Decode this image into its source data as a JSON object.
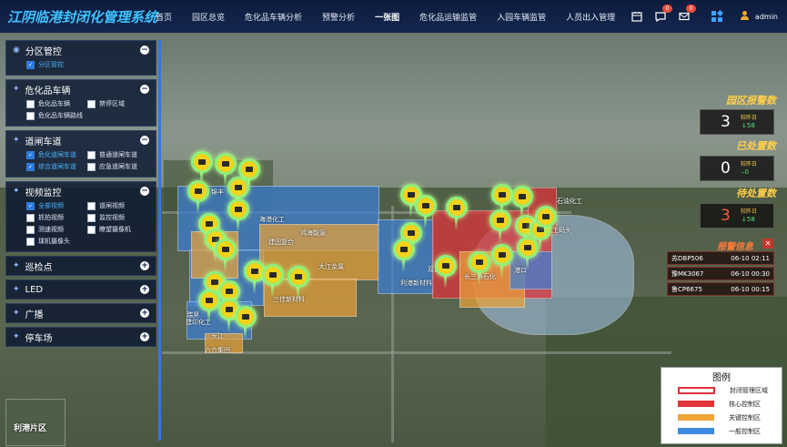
{
  "app": {
    "title": "江阴临港封闭化管理系统"
  },
  "nav": {
    "items": [
      "首页",
      "园区总览",
      "危化品车辆分析",
      "预警分析",
      "一张图",
      "危化品运输监管",
      "入园车辆监管",
      "人员出入管理"
    ],
    "active_index": 4
  },
  "header": {
    "calendar_icon": "calendar-icon",
    "message_badge": "0",
    "mail_badge": "0",
    "user": "admin"
  },
  "left_panel": {
    "sections": [
      {
        "title": "分区管控",
        "icon": "globe-icon",
        "expanded": true,
        "items": [
          {
            "label": "分区管控",
            "checked": true
          }
        ]
      },
      {
        "title": "危化品车辆",
        "icon": "star-icon",
        "expanded": true,
        "items": [
          {
            "label": "危化品车辆",
            "checked": false
          },
          {
            "label": "禁停区域",
            "checked": false
          },
          {
            "label": "危化品车辆路线",
            "checked": false
          }
        ]
      },
      {
        "title": "道闸车道",
        "icon": "star-icon",
        "expanded": true,
        "items": [
          {
            "label": "危化道闸车道",
            "checked": true
          },
          {
            "label": "普通道闸车道",
            "checked": false
          },
          {
            "label": "综合道闸车道",
            "checked": true
          },
          {
            "label": "应急道闸车道",
            "checked": false
          }
        ]
      },
      {
        "title": "视频监控",
        "icon": "star-icon",
        "expanded": true,
        "items": [
          {
            "label": "全部视频",
            "checked": true
          },
          {
            "label": "道闸视频",
            "checked": false
          },
          {
            "label": "抓拍视频",
            "checked": false
          },
          {
            "label": "监控视频",
            "checked": false
          },
          {
            "label": "测速视频",
            "checked": false
          },
          {
            "label": "瞭望摄像机",
            "checked": false
          },
          {
            "label": "球机摄像头",
            "checked": false
          }
        ]
      },
      {
        "title": "巡检点",
        "icon": "star-icon",
        "expanded": false,
        "items": []
      },
      {
        "title": "LED",
        "icon": "star-icon",
        "expanded": false,
        "items": []
      },
      {
        "title": "广播",
        "icon": "star-icon",
        "expanded": false,
        "items": []
      },
      {
        "title": "停车场",
        "icon": "star-icon",
        "expanded": false,
        "items": []
      }
    ]
  },
  "thumbnail": {
    "label": "利港片区"
  },
  "stats": [
    {
      "title": "园区报警数",
      "value": "3",
      "compare_label": "较昨日",
      "delta": "58",
      "direction": "down",
      "value_color": "#ffffff"
    },
    {
      "title": "已处置数",
      "value": "0",
      "compare_label": "较昨日",
      "delta": "0",
      "direction": "flat",
      "value_color": "#ffffff"
    },
    {
      "title": "待处置数",
      "value": "3",
      "compare_label": "较昨日",
      "delta": "58",
      "direction": "down",
      "value_color": "#ff5a3a"
    }
  ],
  "alerts": {
    "title": "报警信息",
    "rows": [
      {
        "plate": "苏DBP506",
        "time": "06-10 02:11"
      },
      {
        "plate": "豫MK3067",
        "time": "06-10 00:30"
      },
      {
        "plate": "鲁CP6675",
        "time": "06-10 00:15"
      }
    ]
  },
  "legend": {
    "title": "图例",
    "items": [
      {
        "label": "封闭管理区域",
        "color": "#e0333a",
        "style": "outline"
      },
      {
        "label": "核心控制区",
        "color": "#e0333a",
        "style": "fill"
      },
      {
        "label": "关键控制区",
        "color": "#f0a537",
        "style": "fill"
      },
      {
        "label": "一般控制区",
        "color": "#3d8ae0",
        "style": "fill"
      }
    ]
  },
  "map_labels": [
    "锦丰",
    "海港化工",
    "鸿海能源",
    "建固复合",
    "大江金属",
    "三佳新材料",
    "双良",
    "利港新材料",
    "长三角石化",
    "港口",
    "石油化工",
    "化工码头",
    "瑞昊",
    "建印化工",
    "长江",
    "六合集团"
  ]
}
